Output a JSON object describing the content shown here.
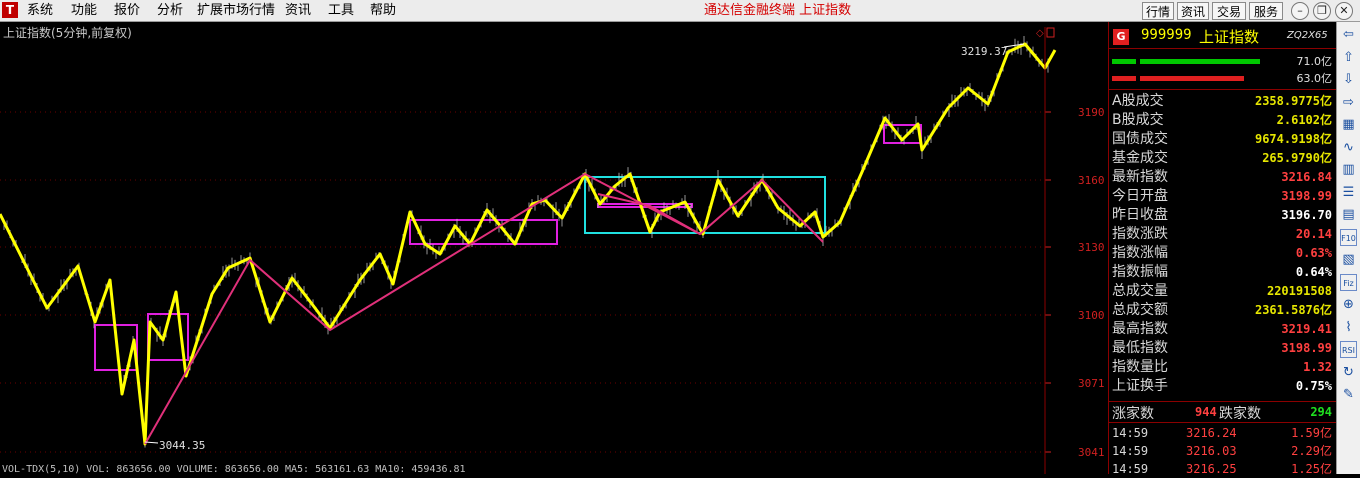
{
  "menubar": {
    "logo": "T",
    "items": [
      "系统",
      "功能",
      "报价",
      "分析",
      "扩展市场行情",
      "资讯",
      "工具",
      "帮助"
    ],
    "center_title": "通达信金融终端   上证指数",
    "buttons": [
      "行情",
      "资讯",
      "交易",
      "服务"
    ]
  },
  "chart": {
    "title": "上证指数(5分钟,前复权)",
    "high_label": "3219.37",
    "low_label": "3044.35",
    "yaxis": [
      "3190",
      "3160",
      "3130",
      "3100",
      "3071",
      "3041"
    ],
    "bottom_text": "VOL-TDX(5,10)  VOL: 863656.00   VOLUME: 863656.00  MA5: 563161.63   MA10: 459436.81",
    "colors": {
      "price": "#ffff00",
      "trend": "#e0307a",
      "box_magenta": "#e020e0",
      "box_cyan": "#20e0e0",
      "grid": "#8b0000",
      "axis": "#d02020"
    }
  },
  "panel": {
    "badge": "G",
    "code": "999999",
    "name": "上证指数",
    "tag": "ZQ2X65",
    "bar_values": [
      "71.0亿",
      "63.0亿"
    ],
    "rows": [
      {
        "label": "A股成交",
        "value": "2358.9775亿",
        "color": "#e6e600"
      },
      {
        "label": "B股成交",
        "value": "2.6102亿",
        "color": "#e6e600"
      },
      {
        "label": "国债成交",
        "value": "9674.9198亿",
        "color": "#e6e600"
      },
      {
        "label": "基金成交",
        "value": "265.9790亿",
        "color": "#e6e600"
      },
      {
        "label": "最新指数",
        "value": "3216.84",
        "color": "#ff4040"
      },
      {
        "label": "今日开盘",
        "value": "3198.99",
        "color": "#ff4040"
      },
      {
        "label": "昨日收盘",
        "value": "3196.70",
        "color": "#ffffff"
      },
      {
        "label": "指数涨跌",
        "value": "20.14",
        "color": "#ff4040"
      },
      {
        "label": "指数涨幅",
        "value": "0.63%",
        "color": "#ff4040"
      },
      {
        "label": "指数振幅",
        "value": "0.64%",
        "color": "#ffffff"
      },
      {
        "label": "总成交量",
        "value": "220191508",
        "color": "#e6e600"
      },
      {
        "label": "总成交额",
        "value": "2361.5876亿",
        "color": "#e6e600"
      },
      {
        "label": "最高指数",
        "value": "3219.41",
        "color": "#ff4040"
      },
      {
        "label": "最低指数",
        "value": "3198.99",
        "color": "#ff4040"
      },
      {
        "label": "指数量比",
        "value": "1.32",
        "color": "#ff4040"
      },
      {
        "label": "上证换手",
        "value": "0.75%",
        "color": "#ffffff"
      }
    ],
    "updown": {
      "up_label": "涨家数",
      "up": "944",
      "down_label": "跌家数",
      "down": "294"
    },
    "ticks": [
      {
        "time": "14:59",
        "price": "3216.24",
        "vol": "1.59亿"
      },
      {
        "time": "14:59",
        "price": "3216.03",
        "vol": "2.29亿"
      },
      {
        "time": "14:59",
        "price": "3216.25",
        "vol": "1.25亿"
      }
    ]
  },
  "sidebar": {
    "icons": [
      "arrow-left-icon",
      "arrow-up-icon",
      "arrow-down-icon",
      "arrow-right-icon",
      "table-icon",
      "line-chart-icon",
      "kline-icon",
      "list-icon",
      "grid-icon",
      "f10-icon",
      "f9-icon",
      "fiz-icon",
      "zoom-icon",
      "indicator-icon",
      "rsi-icon",
      "refresh-icon",
      "pen-icon"
    ],
    "labels": [
      "",
      "",
      "",
      "",
      "",
      "",
      "",
      "",
      "",
      "F10",
      "",
      "Fiz",
      "",
      "",
      "RSI",
      "",
      ""
    ]
  }
}
